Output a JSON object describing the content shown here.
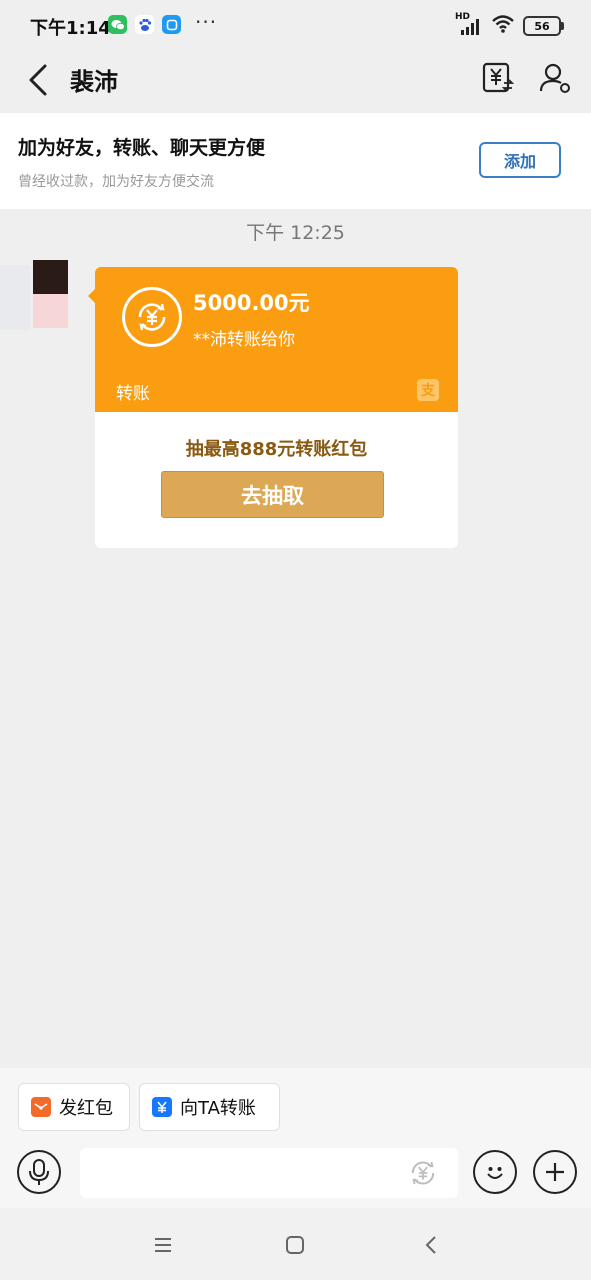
{
  "status_bar": {
    "time": "下午1:14",
    "dots": "···",
    "network": "HD",
    "battery": "56"
  },
  "header": {
    "title": "裴沛"
  },
  "friend_banner": {
    "title": "加为好友，转账、聊天更方便",
    "subtitle": "曾经收过款，加为好友方便交流",
    "add_label": "添加"
  },
  "chat": {
    "timestamp": "下午 12:25",
    "transfer": {
      "amount": "5000.00元",
      "from_text": "**沛转账给你",
      "type_label": "转账",
      "pay_glyph": "支",
      "promo_text": "抽最高888元转账红包",
      "button_label": "去抽取"
    }
  },
  "quick_actions": [
    {
      "label": "发红包"
    },
    {
      "label": "向TA转账"
    }
  ],
  "input": {
    "value": "",
    "placeholder": ""
  },
  "colors": {
    "transfer_orange": "#fb9d11",
    "draw_button": "#dda855",
    "add_button_blue": "#2f72b8",
    "red_packet": "#f36b2b",
    "transfer_blue": "#1677ff"
  }
}
